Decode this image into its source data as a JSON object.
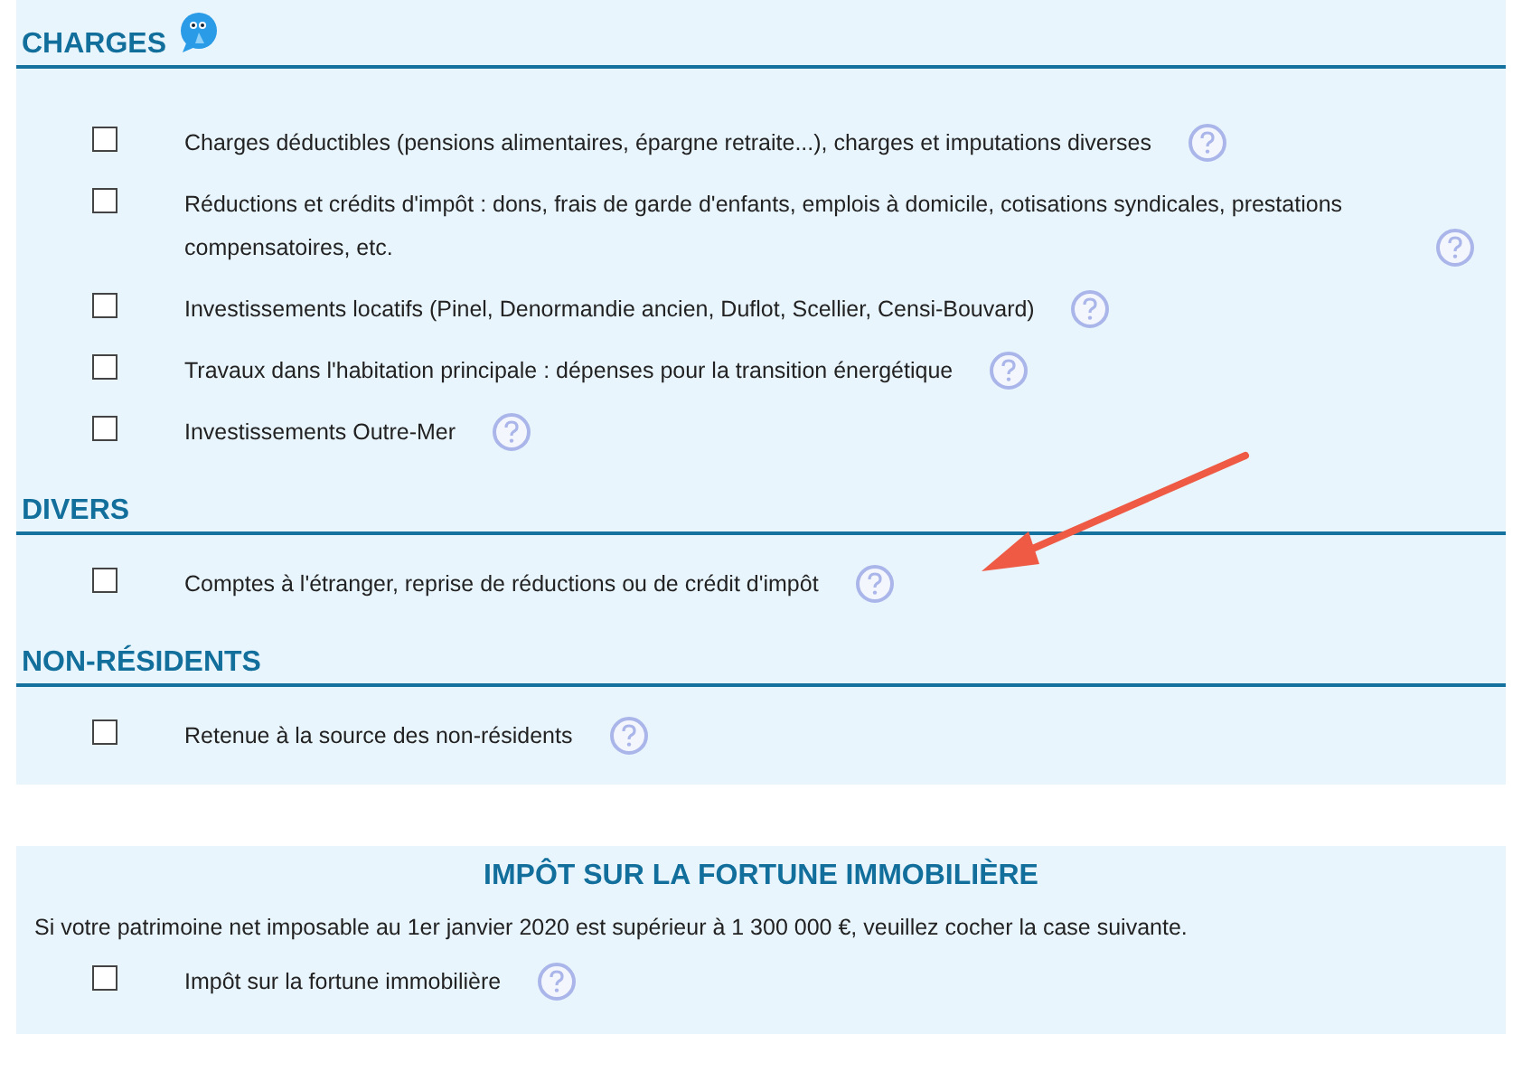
{
  "sections": [
    {
      "title": "CHARGES",
      "mascot": true,
      "items": [
        {
          "label": "Charges déductibles (pensions alimentaires, épargne retraite...), charges et imputations diverses",
          "checked": false
        },
        {
          "label": "Réductions et crédits d'impôt : dons, frais de garde d'enfants, emplois à domicile, cotisations syndicales, prestations compensatoires, etc.",
          "checked": false
        },
        {
          "label": "Investissements locatifs (Pinel, Denormandie ancien, Duflot, Scellier, Censi-Bouvard)",
          "checked": false
        },
        {
          "label": "Travaux dans l'habitation principale : dépenses pour la transition énergétique",
          "checked": false
        },
        {
          "label": "Investissements Outre-Mer",
          "checked": false
        }
      ]
    },
    {
      "title": "DIVERS",
      "items": [
        {
          "label": "Comptes à l'étranger, reprise de réductions ou de crédit d'impôt",
          "checked": false
        }
      ]
    },
    {
      "title": "NON-RÉSIDENTS",
      "items": [
        {
          "label": "Retenue à la source des non-résidents",
          "checked": false
        }
      ]
    }
  ],
  "ifi": {
    "title": "IMPÔT SUR LA FORTUNE IMMOBILIÈRE",
    "note": "Si votre patrimoine net imposable au 1er janvier 2020 est supérieur à 1 300 000 €, veuillez cocher la case suivante.",
    "items": [
      {
        "label": "Impôt sur la fortune immobilière",
        "checked": false
      }
    ]
  }
}
